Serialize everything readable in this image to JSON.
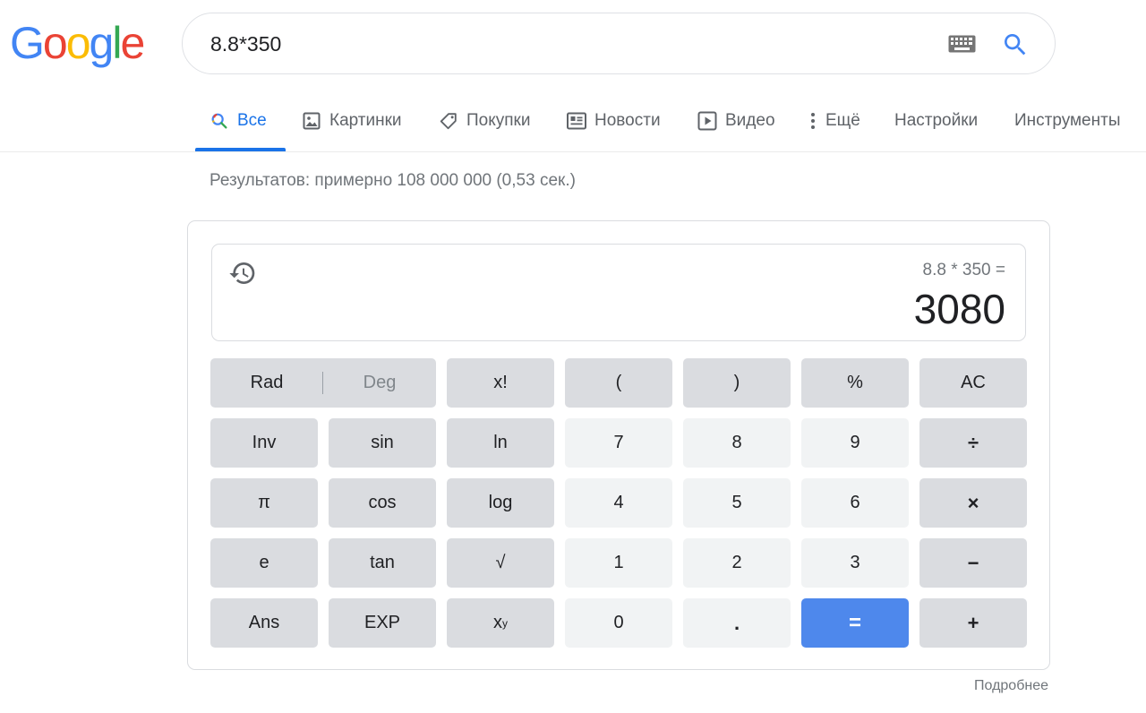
{
  "logo": {
    "letters": [
      "G",
      "o",
      "o",
      "g",
      "l",
      "e"
    ]
  },
  "search": {
    "query": "8.8*350"
  },
  "tabs": {
    "all": "Все",
    "images": "Картинки",
    "shopping": "Покупки",
    "news": "Новости",
    "video": "Видео",
    "more": "Ещё",
    "settings": "Настройки",
    "tools": "Инструменты"
  },
  "result_stats": "Результатов: примерно 108 000 000 (0,53 сек.)",
  "calculator": {
    "expression": "8.8 * 350 =",
    "result": "3080",
    "buttons": {
      "rad": "Rad",
      "deg": "Deg",
      "fact": "x!",
      "lparen": "(",
      "rparen": ")",
      "percent": "%",
      "ac": "AC",
      "inv": "Inv",
      "sin": "sin",
      "ln": "ln",
      "n7": "7",
      "n8": "8",
      "n9": "9",
      "divide": "÷",
      "pi": "π",
      "cos": "cos",
      "log": "log",
      "n4": "4",
      "n5": "5",
      "n6": "6",
      "multiply": "×",
      "e": "e",
      "tan": "tan",
      "sqrt": "√",
      "n1": "1",
      "n2": "2",
      "n3": "3",
      "minus": "−",
      "ans": "Ans",
      "exp": "EXP",
      "pow_base": "x",
      "pow_exp": "y",
      "n0": "0",
      "dot": ".",
      "equals": "=",
      "plus": "+"
    }
  },
  "more_link": "Подробнее",
  "colors": {
    "google_blue": "#4285F4",
    "google_red": "#EA4335",
    "google_yellow": "#FBBC05",
    "google_green": "#34A853",
    "accent": "#1a73e8",
    "equals_button": "#4e88ec"
  }
}
